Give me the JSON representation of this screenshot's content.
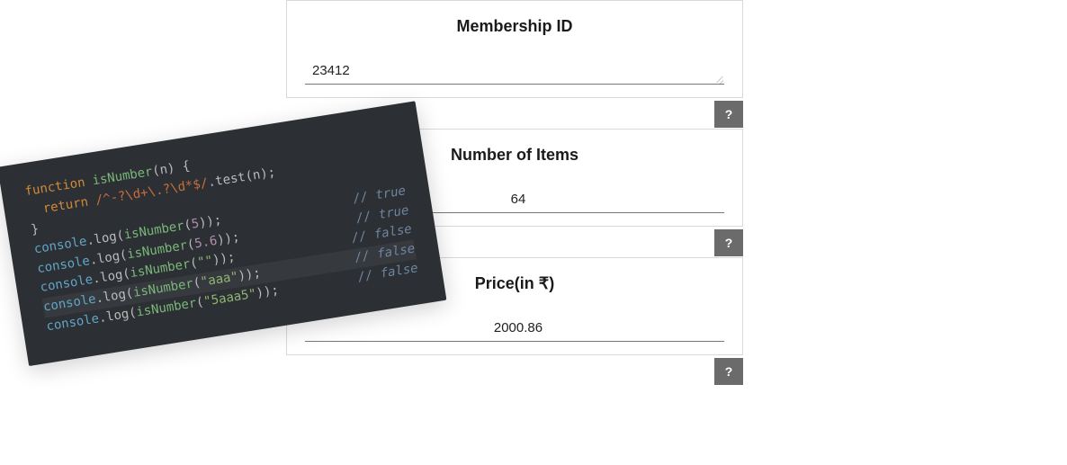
{
  "form": {
    "cards": [
      {
        "title": "Membership ID",
        "value": "23412",
        "align": "left",
        "help": "?"
      },
      {
        "title": "Number of Items",
        "value": "64",
        "align": "center",
        "help": "?"
      },
      {
        "title": "Price(in ₹)",
        "value": "2000.86",
        "align": "center",
        "help": "?"
      }
    ]
  },
  "code": {
    "l1": {
      "kw1": "function ",
      "fn": "isNumber",
      "rest1": "(n) {"
    },
    "l2": {
      "kw": "  return ",
      "re": "/^-?\\d+\\.?\\d*$/",
      "rest": ".test(n);"
    },
    "l3": "}",
    "rows": [
      {
        "left_a": "console",
        "left_b": ".log(",
        "left_c": "isNumber",
        "left_d": "(",
        "arg": "5",
        "left_e": "));",
        "cm": "// true"
      },
      {
        "left_a": "console",
        "left_b": ".log(",
        "left_c": "isNumber",
        "left_d": "(",
        "arg": "5.6",
        "left_e": "));",
        "cm": "// true"
      },
      {
        "left_a": "console",
        "left_b": ".log(",
        "left_c": "isNumber",
        "left_d": "(",
        "arg": "\"\"",
        "left_e": "));",
        "cm": "// false"
      },
      {
        "left_a": "console",
        "left_b": ".log(",
        "left_c": "isNumber",
        "left_d": "(",
        "arg": "\"aaa\"",
        "left_e": "));",
        "cm": "// false",
        "hl": true
      },
      {
        "left_a": "console",
        "left_b": ".log(",
        "left_c": "isNumber",
        "left_d": "(",
        "arg": "\"5aaa5\"",
        "left_e": "));",
        "cm": "// false"
      }
    ]
  }
}
